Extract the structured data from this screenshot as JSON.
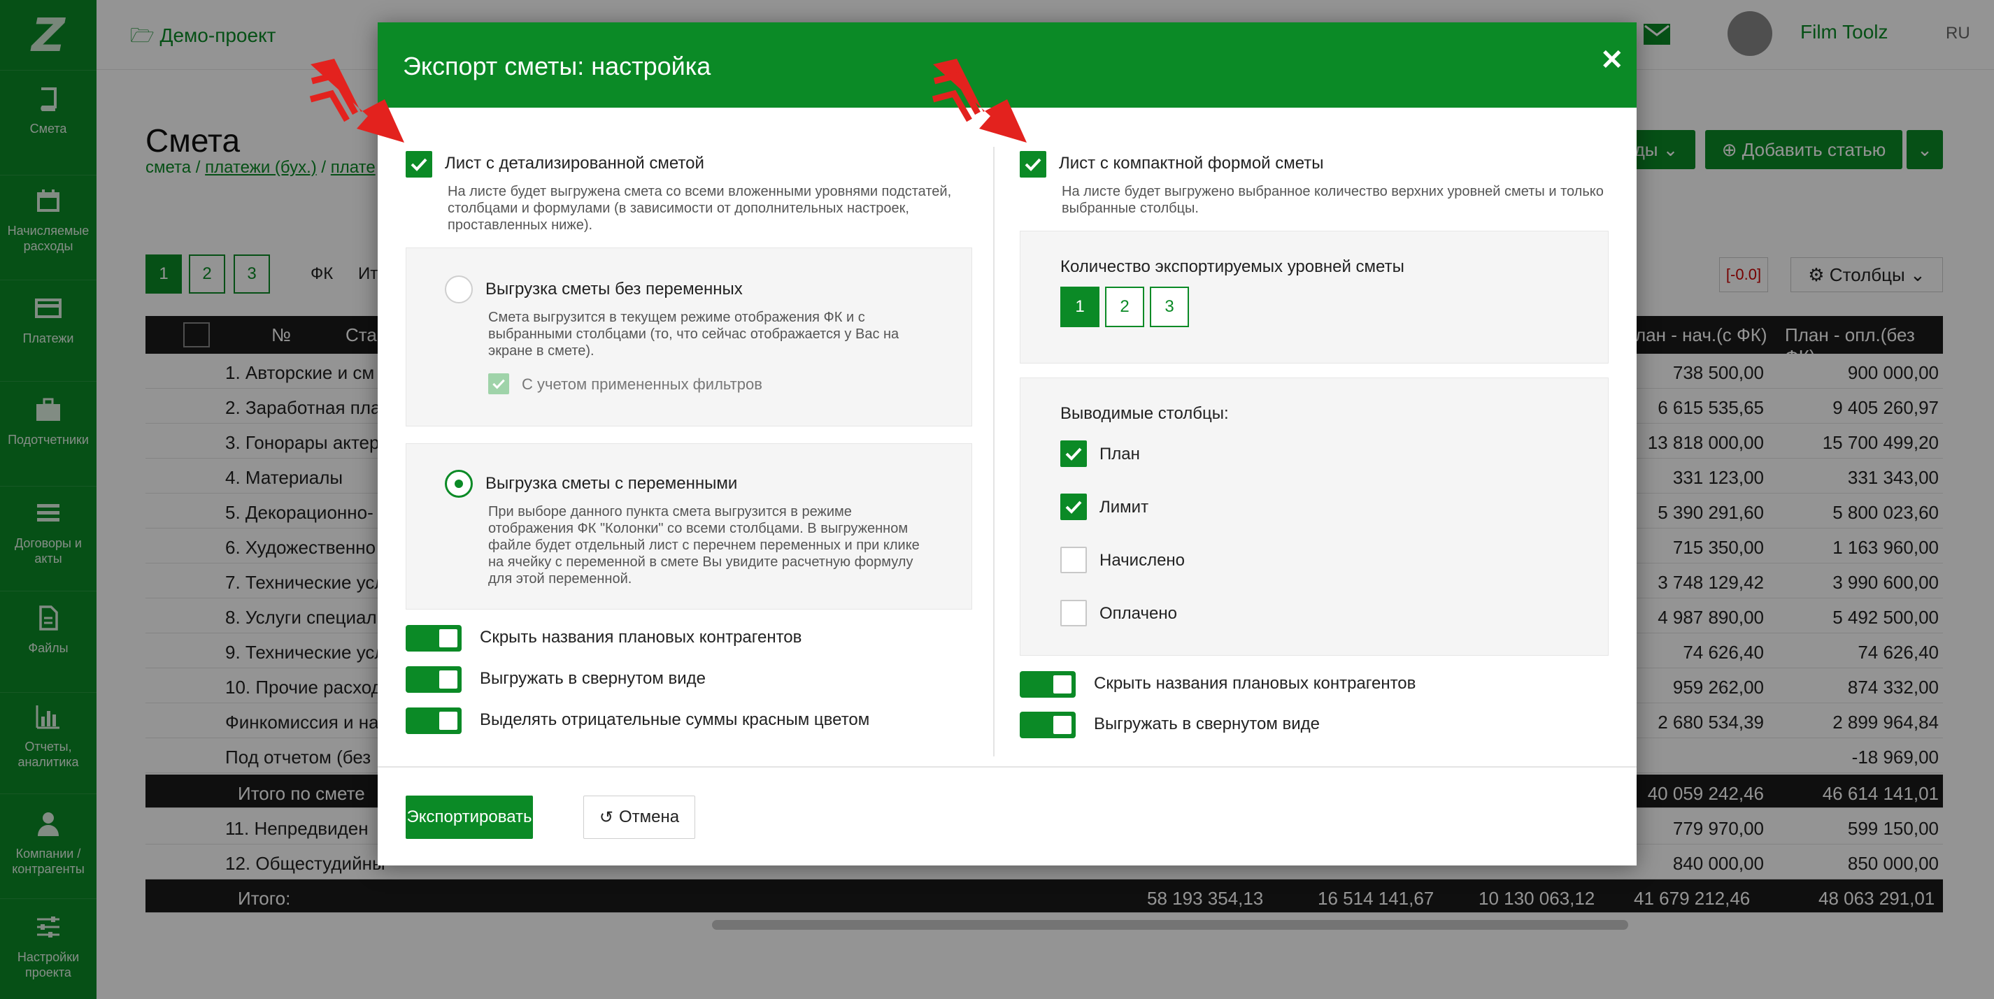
{
  "sidebar": {
    "logo": "Z",
    "items": [
      {
        "label": "Смета",
        "icon": "book-icon"
      },
      {
        "label": "Начисляемые расходы",
        "icon": "calendar-icon"
      },
      {
        "label": "Платежи",
        "icon": "payments-icon"
      },
      {
        "label": "Подотчетники",
        "icon": "briefcase-icon"
      },
      {
        "label": "Договоры и акты",
        "icon": "list-icon"
      },
      {
        "label": "Файлы",
        "icon": "file-icon"
      },
      {
        "label": "Отчеты, аналитика",
        "icon": "bar-chart-icon"
      },
      {
        "label": "Компании / контрагенты",
        "icon": "user-icon"
      },
      {
        "label": "Настройки проекта",
        "icon": "sliders-icon"
      }
    ]
  },
  "topbar": {
    "project": "Демо-проект",
    "user": "Film Toolz",
    "lang": "RU"
  },
  "page": {
    "title": "Смета",
    "crumb_1": "смета",
    "crumb_2": "платежи (бух.)",
    "crumb_3": "плате",
    "add_button": "Добавить статью",
    "other_button": "ды",
    "columns_button": "Столбцы",
    "neg_badge": "[-0.0]",
    "filter_fk": "ФК",
    "filter_it": "Ит",
    "pages": [
      "1",
      "2",
      "3"
    ]
  },
  "table": {
    "headers": {
      "num": "№",
      "status": "Ста",
      "plan_acc": "лан - нач.(с ФК)",
      "plan_pay": "План - опл.(без ФК)"
    },
    "rows": [
      {
        "name": "1. Авторские и см",
        "c1": "738 500,00",
        "c2": "900 000,00"
      },
      {
        "name": "2. Заработная пла",
        "c1": "6 615 535,65",
        "c2": "9 405 260,97"
      },
      {
        "name": "3. Гонорары актер",
        "c1": "13 818 000,00",
        "c2": "15 700 499,20"
      },
      {
        "name": "4. Материалы",
        "c1": "331 123,00",
        "c2": "331 343,00"
      },
      {
        "name": "5. Декорационно-",
        "c1": "5 390 291,60",
        "c2": "5 800 023,60"
      },
      {
        "name": "6. Художественно",
        "c1": "715 350,00",
        "c2": "1 163 960,00"
      },
      {
        "name": "7. Технические усл",
        "c1": "3 748 129,42",
        "c2": "3 990 600,00"
      },
      {
        "name": "8. Услуги специал",
        "c1": "4 987 890,00",
        "c2": "5 492 500,00"
      },
      {
        "name": "9. Технические усл",
        "c1": "74 626,40",
        "c2": "74 626,40"
      },
      {
        "name": "10. Прочие расход",
        "c1": "959 262,00",
        "c2": "874 332,00"
      },
      {
        "name": "Финкомиссия и на",
        "c1": "2 680 534,39",
        "c2": "2 899 964,84"
      },
      {
        "name": "Под отчетом (без",
        "c1": "",
        "c2": "-18 969,00"
      }
    ],
    "subtotal": {
      "name": "Итого по смете",
      "c1": "40 059 242,46",
      "c2": "46 614 141,01"
    },
    "rows_after": [
      {
        "name": "11. Непредвиден",
        "c1": "779 970,00",
        "c2": "599 150,00"
      },
      {
        "name": "12. Общестудийны",
        "c1": "840 000,00",
        "c2": "850 000,00"
      }
    ],
    "total": {
      "name": "Итого:",
      "v1": "58 193 354,13",
      "v2": "16 514 141,67",
      "v3": "10 130 063,12",
      "v4": "41 679 212,46",
      "v5": "48 063 291,01"
    }
  },
  "modal": {
    "title": "Экспорт сметы: настройка",
    "left": {
      "main_checkbox": "Лист с детализированной сметой",
      "main_desc": "На листе будет выгружена смета со всеми вложенными уровнями подстатей, столбцами и формулами (в зависимости от дополнительных настроек, проставленных ниже).",
      "radio1_label": "Выгрузка сметы без переменных",
      "radio1_desc": "Смета выгрузится в текущем режиме отображения ФК и с выбранными столбцами (то, что сейчас отображается у Вас на экране в смете).",
      "radio1_sub": "С учетом примененных фильтров",
      "radio2_label": "Выгрузка сметы с переменными",
      "radio2_desc": "При выборе данного пункта смета выгрузится в режиме отображения ФК \"Колонки\" со всеми столбцами. В выгруженном файле будет отдельный лист с перечнем переменных и при клике на ячейку с переменной в смете Вы увидите расчетную формулу для этой переменной.",
      "toggles": [
        "Скрыть названия плановых контрагентов",
        "Выгружать в свернутом виде",
        "Выделять отрицательные суммы красным цветом"
      ]
    },
    "right": {
      "main_checkbox": "Лист с компактной формой сметы",
      "main_desc": "На листе будет выгружено выбранное количество верхних уровней сметы и только выбранные столбцы.",
      "levels_label": "Количество экспортируемых уровней сметы",
      "levels": [
        "1",
        "2",
        "3"
      ],
      "columns_label": "Выводимые столбцы:",
      "columns": [
        {
          "label": "План",
          "checked": true
        },
        {
          "label": "Лимит",
          "checked": true
        },
        {
          "label": "Начислено",
          "checked": false
        },
        {
          "label": "Оплачено",
          "checked": false
        }
      ],
      "toggles": [
        "Скрыть названия плановых контрагентов",
        "Выгружать в свернутом виде"
      ]
    },
    "export_button": "Экспортировать",
    "cancel_button": "Отмена"
  },
  "colors": {
    "brand_green": "#0b8a26",
    "arrow_red": "#e3221e"
  }
}
